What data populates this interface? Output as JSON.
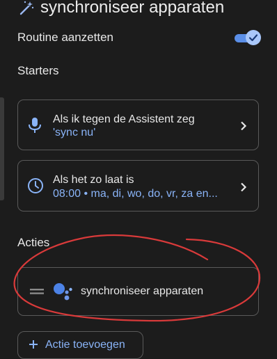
{
  "header": {
    "title": "synchroniseer apparaten",
    "icon": "magic-wand-icon"
  },
  "routine_toggle": {
    "label": "Routine aanzetten",
    "state": "on",
    "accent": "#a9c7fa"
  },
  "starters": {
    "title": "Starters",
    "items": [
      {
        "line1": "Als ik tegen de Assistent zeg",
        "line2": "'sync nu'",
        "icon": "microphone-icon"
      },
      {
        "line1": "Als het zo laat is",
        "line2": "08:00 • ma, di, wo, do, vr, za en...",
        "icon": "clock-icon"
      }
    ]
  },
  "actions": {
    "title": "Acties",
    "items": [
      {
        "label": "synchroniseer apparaten",
        "icon": "google-assistant-icon"
      }
    ],
    "add_label": "Actie toevoegen"
  },
  "colors": {
    "link": "#8ab4f8",
    "annotation": "#d93a3a",
    "background": "#1c1c1c"
  }
}
